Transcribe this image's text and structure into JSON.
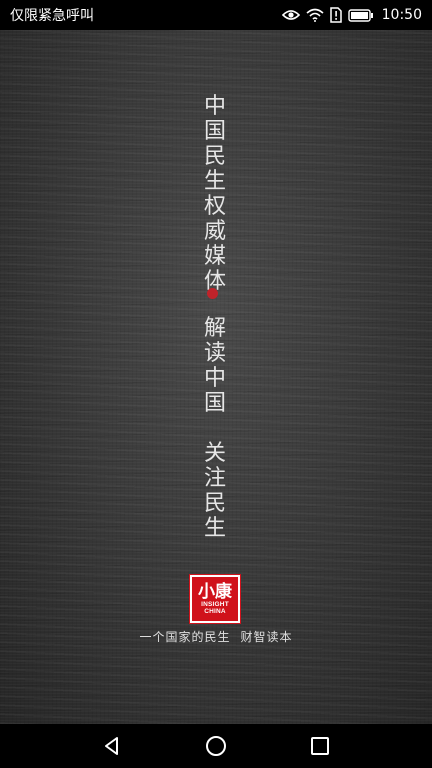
{
  "status_bar": {
    "carrier_text": "仅限紧急呼叫",
    "time": "10:50",
    "icons": [
      "eye-icon",
      "wifi-icon",
      "sim-icon",
      "battery-icon"
    ]
  },
  "splash": {
    "slogan_top": [
      "中",
      "国",
      "民",
      "生",
      "权",
      "威",
      "媒",
      "体"
    ],
    "slogan_bottom": [
      "解",
      "读",
      "中",
      "国",
      "",
      "关",
      "注",
      "民",
      "生"
    ],
    "logo_cn": "小康",
    "logo_en_1": "INSIGHT",
    "logo_en_2": "CHINA",
    "tagline_1": "一个国家的民生",
    "tagline_2": "财智读本"
  },
  "nav_bar": {
    "buttons": [
      "back-icon",
      "home-icon",
      "recents-icon"
    ]
  },
  "colors": {
    "accent_red": "#d0121b",
    "dot_red": "#c0232a",
    "text_light": "#e6e6e6"
  }
}
